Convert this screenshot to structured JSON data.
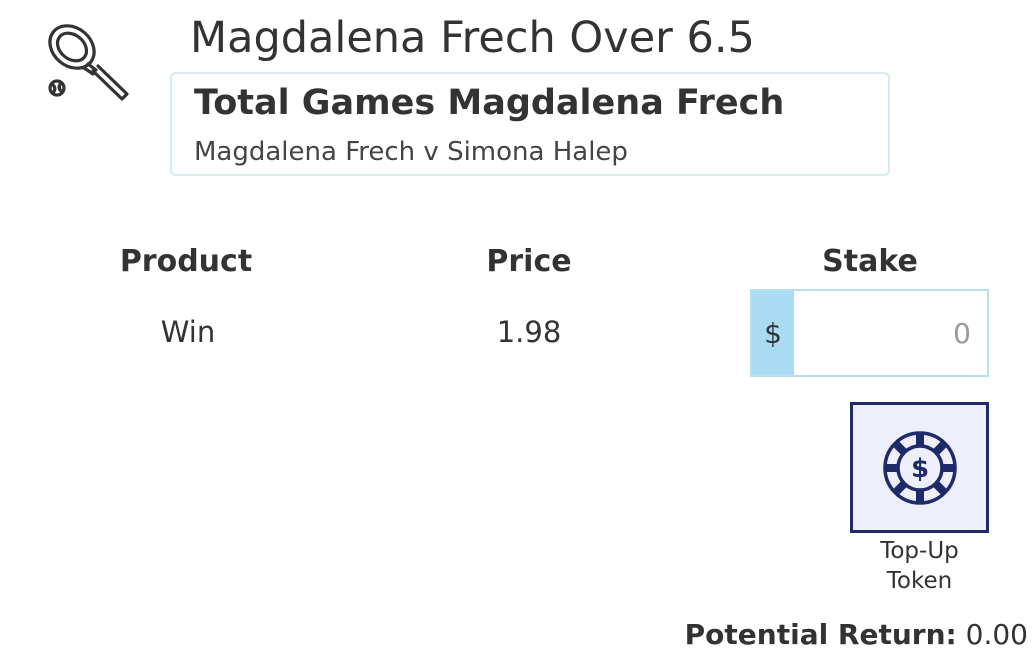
{
  "bet": {
    "title": "Magdalena Frech Over 6.5",
    "sport_icon": "tennis-racket-icon",
    "market": "Total Games Magdalena Frech",
    "event": "Magdalena Frech v Simona Halep"
  },
  "table": {
    "headers": {
      "product": "Product",
      "price": "Price",
      "stake": "Stake"
    },
    "row": {
      "product": "Win",
      "price": "1.98"
    }
  },
  "stake_input": {
    "currency": "$",
    "value": "",
    "placeholder": "0"
  },
  "token": {
    "icon": "dollar-chip-icon",
    "label_line1": "Top-Up",
    "label_line2": "Token"
  },
  "potential_return": {
    "label": "Potential Return:",
    "value": "0.00"
  },
  "colors": {
    "accent_light_blue": "#a9dbf2",
    "token_navy": "#1f2a6b",
    "token_bg": "#edf0fb",
    "text": "#333333"
  }
}
